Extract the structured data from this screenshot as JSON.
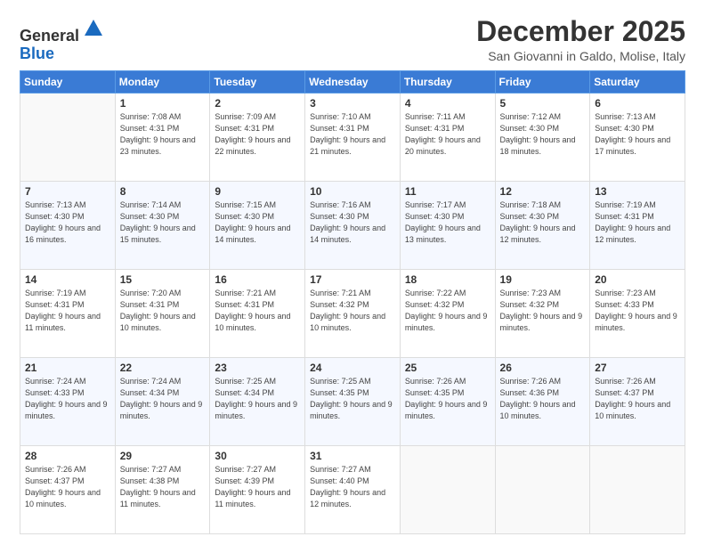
{
  "logo": {
    "line1": "General",
    "line2": "Blue"
  },
  "title": "December 2025",
  "subtitle": "San Giovanni in Galdo, Molise, Italy",
  "days": [
    "Sunday",
    "Monday",
    "Tuesday",
    "Wednesday",
    "Thursday",
    "Friday",
    "Saturday"
  ],
  "weeks": [
    [
      {
        "num": "",
        "sunrise": "",
        "sunset": "",
        "daylight": ""
      },
      {
        "num": "1",
        "sunrise": "Sunrise: 7:08 AM",
        "sunset": "Sunset: 4:31 PM",
        "daylight": "Daylight: 9 hours and 23 minutes."
      },
      {
        "num": "2",
        "sunrise": "Sunrise: 7:09 AM",
        "sunset": "Sunset: 4:31 PM",
        "daylight": "Daylight: 9 hours and 22 minutes."
      },
      {
        "num": "3",
        "sunrise": "Sunrise: 7:10 AM",
        "sunset": "Sunset: 4:31 PM",
        "daylight": "Daylight: 9 hours and 21 minutes."
      },
      {
        "num": "4",
        "sunrise": "Sunrise: 7:11 AM",
        "sunset": "Sunset: 4:31 PM",
        "daylight": "Daylight: 9 hours and 20 minutes."
      },
      {
        "num": "5",
        "sunrise": "Sunrise: 7:12 AM",
        "sunset": "Sunset: 4:30 PM",
        "daylight": "Daylight: 9 hours and 18 minutes."
      },
      {
        "num": "6",
        "sunrise": "Sunrise: 7:13 AM",
        "sunset": "Sunset: 4:30 PM",
        "daylight": "Daylight: 9 hours and 17 minutes."
      }
    ],
    [
      {
        "num": "7",
        "sunrise": "Sunrise: 7:13 AM",
        "sunset": "Sunset: 4:30 PM",
        "daylight": "Daylight: 9 hours and 16 minutes."
      },
      {
        "num": "8",
        "sunrise": "Sunrise: 7:14 AM",
        "sunset": "Sunset: 4:30 PM",
        "daylight": "Daylight: 9 hours and 15 minutes."
      },
      {
        "num": "9",
        "sunrise": "Sunrise: 7:15 AM",
        "sunset": "Sunset: 4:30 PM",
        "daylight": "Daylight: 9 hours and 14 minutes."
      },
      {
        "num": "10",
        "sunrise": "Sunrise: 7:16 AM",
        "sunset": "Sunset: 4:30 PM",
        "daylight": "Daylight: 9 hours and 14 minutes."
      },
      {
        "num": "11",
        "sunrise": "Sunrise: 7:17 AM",
        "sunset": "Sunset: 4:30 PM",
        "daylight": "Daylight: 9 hours and 13 minutes."
      },
      {
        "num": "12",
        "sunrise": "Sunrise: 7:18 AM",
        "sunset": "Sunset: 4:30 PM",
        "daylight": "Daylight: 9 hours and 12 minutes."
      },
      {
        "num": "13",
        "sunrise": "Sunrise: 7:19 AM",
        "sunset": "Sunset: 4:31 PM",
        "daylight": "Daylight: 9 hours and 12 minutes."
      }
    ],
    [
      {
        "num": "14",
        "sunrise": "Sunrise: 7:19 AM",
        "sunset": "Sunset: 4:31 PM",
        "daylight": "Daylight: 9 hours and 11 minutes."
      },
      {
        "num": "15",
        "sunrise": "Sunrise: 7:20 AM",
        "sunset": "Sunset: 4:31 PM",
        "daylight": "Daylight: 9 hours and 10 minutes."
      },
      {
        "num": "16",
        "sunrise": "Sunrise: 7:21 AM",
        "sunset": "Sunset: 4:31 PM",
        "daylight": "Daylight: 9 hours and 10 minutes."
      },
      {
        "num": "17",
        "sunrise": "Sunrise: 7:21 AM",
        "sunset": "Sunset: 4:32 PM",
        "daylight": "Daylight: 9 hours and 10 minutes."
      },
      {
        "num": "18",
        "sunrise": "Sunrise: 7:22 AM",
        "sunset": "Sunset: 4:32 PM",
        "daylight": "Daylight: 9 hours and 9 minutes."
      },
      {
        "num": "19",
        "sunrise": "Sunrise: 7:23 AM",
        "sunset": "Sunset: 4:32 PM",
        "daylight": "Daylight: 9 hours and 9 minutes."
      },
      {
        "num": "20",
        "sunrise": "Sunrise: 7:23 AM",
        "sunset": "Sunset: 4:33 PM",
        "daylight": "Daylight: 9 hours and 9 minutes."
      }
    ],
    [
      {
        "num": "21",
        "sunrise": "Sunrise: 7:24 AM",
        "sunset": "Sunset: 4:33 PM",
        "daylight": "Daylight: 9 hours and 9 minutes."
      },
      {
        "num": "22",
        "sunrise": "Sunrise: 7:24 AM",
        "sunset": "Sunset: 4:34 PM",
        "daylight": "Daylight: 9 hours and 9 minutes."
      },
      {
        "num": "23",
        "sunrise": "Sunrise: 7:25 AM",
        "sunset": "Sunset: 4:34 PM",
        "daylight": "Daylight: 9 hours and 9 minutes."
      },
      {
        "num": "24",
        "sunrise": "Sunrise: 7:25 AM",
        "sunset": "Sunset: 4:35 PM",
        "daylight": "Daylight: 9 hours and 9 minutes."
      },
      {
        "num": "25",
        "sunrise": "Sunrise: 7:26 AM",
        "sunset": "Sunset: 4:35 PM",
        "daylight": "Daylight: 9 hours and 9 minutes."
      },
      {
        "num": "26",
        "sunrise": "Sunrise: 7:26 AM",
        "sunset": "Sunset: 4:36 PM",
        "daylight": "Daylight: 9 hours and 10 minutes."
      },
      {
        "num": "27",
        "sunrise": "Sunrise: 7:26 AM",
        "sunset": "Sunset: 4:37 PM",
        "daylight": "Daylight: 9 hours and 10 minutes."
      }
    ],
    [
      {
        "num": "28",
        "sunrise": "Sunrise: 7:26 AM",
        "sunset": "Sunset: 4:37 PM",
        "daylight": "Daylight: 9 hours and 10 minutes."
      },
      {
        "num": "29",
        "sunrise": "Sunrise: 7:27 AM",
        "sunset": "Sunset: 4:38 PM",
        "daylight": "Daylight: 9 hours and 11 minutes."
      },
      {
        "num": "30",
        "sunrise": "Sunrise: 7:27 AM",
        "sunset": "Sunset: 4:39 PM",
        "daylight": "Daylight: 9 hours and 11 minutes."
      },
      {
        "num": "31",
        "sunrise": "Sunrise: 7:27 AM",
        "sunset": "Sunset: 4:40 PM",
        "daylight": "Daylight: 9 hours and 12 minutes."
      },
      {
        "num": "",
        "sunrise": "",
        "sunset": "",
        "daylight": ""
      },
      {
        "num": "",
        "sunrise": "",
        "sunset": "",
        "daylight": ""
      },
      {
        "num": "",
        "sunrise": "",
        "sunset": "",
        "daylight": ""
      }
    ]
  ]
}
